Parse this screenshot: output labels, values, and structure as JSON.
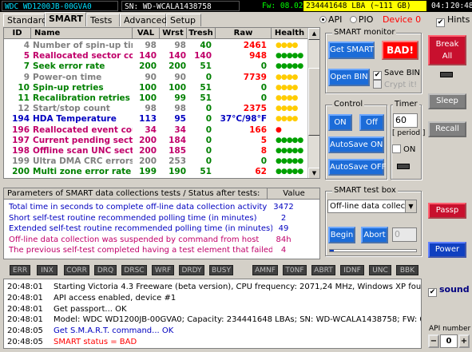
{
  "topbar": {
    "model": "WDC WD1200JB-00GVA0",
    "serial": "SN: WD-WCALA1438758",
    "firmware": "Fw: 08.02D08",
    "lba": "234441648 LBA (~111 GB)",
    "time1": "04:12",
    "time2": "20:48:57"
  },
  "tabs": [
    "Standard",
    "SMART",
    "Tests",
    "Advanced",
    "Setup"
  ],
  "mode": {
    "api": "API",
    "pio": "PIO",
    "device": "Device 0"
  },
  "hints_label": "Hints",
  "smart_table": {
    "headers": [
      "ID",
      "Name",
      "VAL",
      "Wrst",
      "Tresh",
      "Raw",
      "Health"
    ],
    "rows": [
      {
        "id": "4",
        "name": "Number of spin-up times",
        "val": "98",
        "wrst": "98",
        "tresh": "40",
        "raw": "2461",
        "health": "●●●●",
        "color": "#808080",
        "tcolor": "#008000",
        "rawcolor": "#ff0000",
        "hcolor": "#ffcc00"
      },
      {
        "id": "5",
        "name": "Reallocated sector count",
        "val": "140",
        "wrst": "140",
        "tresh": "140",
        "raw": "948",
        "health": "●●●●●",
        "color": "#c0006a",
        "tcolor": "#c0006a",
        "rawcolor": "#ff0000",
        "hcolor": "#00a000"
      },
      {
        "id": "7",
        "name": "Seek error rate",
        "val": "200",
        "wrst": "200",
        "tresh": "51",
        "raw": "0",
        "health": "●●●●●",
        "color": "#008000",
        "tcolor": "#008000",
        "rawcolor": "#008000",
        "hcolor": "#00a000"
      },
      {
        "id": "9",
        "name": "Power-on time",
        "val": "90",
        "wrst": "90",
        "tresh": "0",
        "raw": "7739",
        "health": "●●●●",
        "color": "#808080",
        "tcolor": "#008000",
        "rawcolor": "#ff0000",
        "hcolor": "#ffcc00"
      },
      {
        "id": "10",
        "name": "Spin-up retries",
        "val": "100",
        "wrst": "100",
        "tresh": "51",
        "raw": "0",
        "health": "●●●●",
        "color": "#008000",
        "tcolor": "#008000",
        "rawcolor": "#008000",
        "hcolor": "#ffcc00"
      },
      {
        "id": "11",
        "name": "Recalibration retries",
        "val": "100",
        "wrst": "99",
        "tresh": "51",
        "raw": "0",
        "health": "●●●●",
        "color": "#008000",
        "tcolor": "#008000",
        "rawcolor": "#008000",
        "hcolor": "#ffcc00"
      },
      {
        "id": "12",
        "name": "Start/stop count",
        "val": "98",
        "wrst": "98",
        "tresh": "0",
        "raw": "2375",
        "health": "●●●●",
        "color": "#808080",
        "tcolor": "#008000",
        "rawcolor": "#ff0000",
        "hcolor": "#ffcc00"
      },
      {
        "id": "194",
        "name": "HDA Temperature",
        "val": "113",
        "wrst": "95",
        "tresh": "0",
        "raw": "37°C/98°F",
        "health": "●●●●",
        "color": "#0000c0",
        "tcolor": "#008000",
        "rawcolor": "#0000c0",
        "hcolor": "#ffcc00"
      },
      {
        "id": "196",
        "name": "Reallocated event count",
        "val": "34",
        "wrst": "34",
        "tresh": "0",
        "raw": "166",
        "health": "●",
        "color": "#c0006a",
        "tcolor": "#008000",
        "rawcolor": "#ff0000",
        "hcolor": "#ff0000"
      },
      {
        "id": "197",
        "name": "Current pending sectors",
        "val": "200",
        "wrst": "184",
        "tresh": "0",
        "raw": "5",
        "health": "●●●●●",
        "color": "#c0006a",
        "tcolor": "#008000",
        "rawcolor": "#ff0000",
        "hcolor": "#00a000"
      },
      {
        "id": "198",
        "name": "Offline scan UNC sectors",
        "val": "200",
        "wrst": "185",
        "tresh": "0",
        "raw": "8",
        "health": "●●●●●",
        "color": "#c0006a",
        "tcolor": "#008000",
        "rawcolor": "#ff0000",
        "hcolor": "#00a000"
      },
      {
        "id": "199",
        "name": "Ultra DMA CRC errors",
        "val": "200",
        "wrst": "253",
        "tresh": "0",
        "raw": "0",
        "health": "●●●●●",
        "color": "#808080",
        "tcolor": "#008000",
        "rawcolor": "#008000",
        "hcolor": "#00a000"
      },
      {
        "id": "200",
        "name": "Multi zone error rate",
        "val": "199",
        "wrst": "190",
        "tresh": "51",
        "raw": "62",
        "health": "●●●●●",
        "color": "#008000",
        "tcolor": "#008000",
        "rawcolor": "#ff0000",
        "hcolor": "#00a000"
      }
    ]
  },
  "tests_table": {
    "header_desc": "Parameters of SMART data collections tests / Status after tests:",
    "header_val": "Value",
    "rows": [
      {
        "desc": "Total time in seconds to complete off-line data collection activity",
        "value": "3472",
        "color": "#0000c0"
      },
      {
        "desc": "Short self-test routine recommended polling time (in minutes)",
        "value": "2",
        "color": "#0000c0"
      },
      {
        "desc": "Extended self-test routine recommended polling time (in minutes)",
        "value": "49",
        "color": "#0000c0"
      },
      {
        "desc": "Off-line data collection was suspended by command from host",
        "value": "84h",
        "color": "#c0006a"
      },
      {
        "desc": "The previous self-test completed having a test element that failed...",
        "value": "4",
        "color": "#c0006a"
      }
    ]
  },
  "smart_monitor": {
    "title": "SMART monitor",
    "get_smart": "Get SMART",
    "status": "BAD!",
    "open_bin": "Open BIN",
    "save_bin": "Save BIN",
    "crypt_it": "Crypt it!"
  },
  "control": {
    "title": "Control",
    "on": "ON",
    "off": "Off",
    "autosave_on": "AutoSave ON",
    "autosave_off": "AutoSave OFF"
  },
  "timer": {
    "title": "Timer",
    "value": "60",
    "period": "[ period ]",
    "on": "ON"
  },
  "test_box": {
    "title": "SMART test box",
    "selected": "Off-line data collect",
    "begin": "Begin",
    "abort": "Abort",
    "count": "0"
  },
  "side_buttons": {
    "break_all": "Break All",
    "sleep": "Sleep",
    "recall": "Recall",
    "passp": "Passp",
    "power": "Power"
  },
  "flags": [
    "ERR",
    "INX",
    "CORR",
    "DRQ",
    "DRSC",
    "WRF",
    "DRDY",
    "BUSY",
    "AMNF",
    "T0NF",
    "ABRT",
    "IDNF",
    "UNC",
    "BBK"
  ],
  "log": [
    {
      "time": "20:48:01",
      "msg": "Starting Victoria 4.3 Freeware (beta version), CPU frequency: 2071,24 MHz, Windows XP found.",
      "color": "#000000"
    },
    {
      "time": "20:48:01",
      "msg": "API access enabled, device #1",
      "color": "#000000"
    },
    {
      "time": "20:48:01",
      "msg": "Get passport... OK",
      "color": "#000000"
    },
    {
      "time": "20:48:01",
      "msg": "Model: WDC WD1200JB-00GVA0; Capacity: 234441648 LBAs; SN: WD-WCALA1438758; FW: 08....",
      "color": "#000000"
    },
    {
      "time": "20:48:05",
      "msg": "Get S.M.A.R.T. command... OK",
      "color": "#0000c0"
    },
    {
      "time": "20:48:05",
      "msg": "SMART status = BAD",
      "color": "#ff0000"
    }
  ],
  "sound_label": "sound",
  "api_number": {
    "label": "API number",
    "minus": "−",
    "value": "0",
    "plus": "+"
  }
}
